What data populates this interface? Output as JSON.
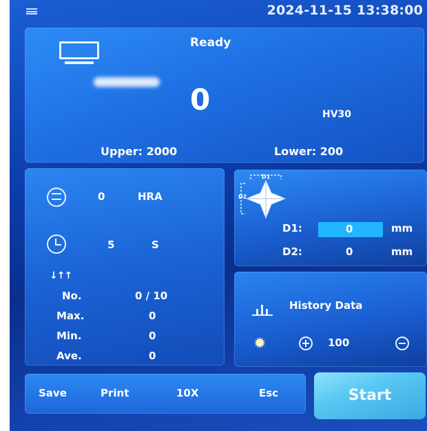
{
  "header": {
    "datetime": "2024-11-15 13:38:00"
  },
  "display": {
    "status": "Ready",
    "reading": "0",
    "unit": "HV30",
    "upper": "Upper: 2000",
    "lower": "Lower: 200"
  },
  "conversion": {
    "value": "0",
    "scale": "HRA"
  },
  "dwell": {
    "value": "5",
    "unit": "S"
  },
  "stats": {
    "no_label": "No.",
    "no_value": "0 / 10",
    "max_label": "Max.",
    "max_value": "0",
    "min_label": "Min.",
    "min_value": "0",
    "ave_label": "Ave.",
    "ave_value": "0"
  },
  "diagonals": {
    "diagram_d1": "D1",
    "diagram_d2": "D2",
    "d1_label": "D1:",
    "d1_value": "0",
    "d1_unit": "mm",
    "d2_label": "D2:",
    "d2_value": "0",
    "d2_unit": "mm"
  },
  "history": {
    "label": "History Data"
  },
  "light": {
    "value": "100"
  },
  "toolbar": {
    "save": "Save",
    "print": "Print",
    "lens": "10X",
    "esc": "Esc",
    "start": "Start"
  },
  "colors": {
    "accent_field": "#22b6ff",
    "panel_blue": "#1e6fe2",
    "start_cyan": "#58c7f2"
  }
}
